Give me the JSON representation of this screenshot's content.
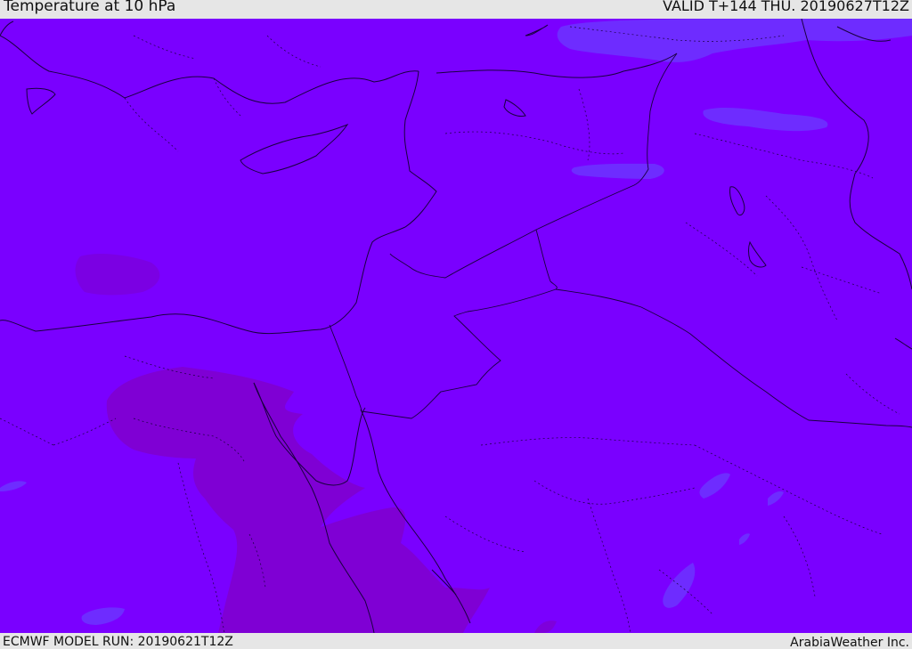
{
  "header": {
    "title": "Temperature at 10 hPa",
    "valid": "VALID T+144 THU. 20190627T12Z"
  },
  "footer": {
    "model_run": "ECMWF MODEL RUN: 20190621T12Z",
    "credit": "ArabiaWeather Inc."
  },
  "map": {
    "field_colors": {
      "base": "#7a00ff",
      "warm": "#7b00e0",
      "warmer": "#8000cc",
      "cool": "#6e2cff"
    },
    "border_color": "#1a0040"
  }
}
